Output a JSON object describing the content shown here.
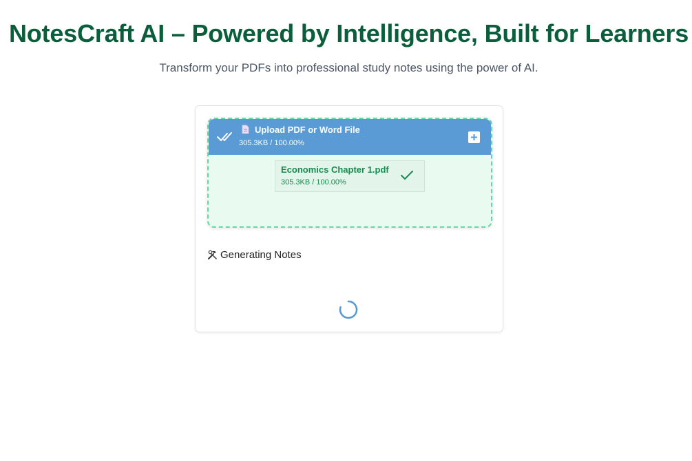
{
  "header": {
    "title": "NotesCraft AI – Powered by Intelligence, Built for Learners",
    "subtitle": "Transform your PDFs into professional study notes using the power of AI."
  },
  "uploader": {
    "header_title": "Upload PDF or Word File",
    "header_status": "305.3KB / 100.00%",
    "icons": [
      "check-all-icon",
      "document-icon",
      "plus-icon"
    ],
    "files": [
      {
        "name": "Economics Chapter 1.pdf",
        "status": "305.3KB / 100.00%",
        "icon": "checkmark-icon"
      }
    ]
  },
  "generation": {
    "label": "Generating Notes",
    "icon": "hammer-wrench-icon",
    "loading_icon": "spinner-icon"
  },
  "colors": {
    "title": "#0b5e3c",
    "header_bar": "#5a9bd6",
    "dropzone_bg": "#e9faf1",
    "dropzone_border": "#6ad3a7",
    "file_text": "#168a4f"
  }
}
